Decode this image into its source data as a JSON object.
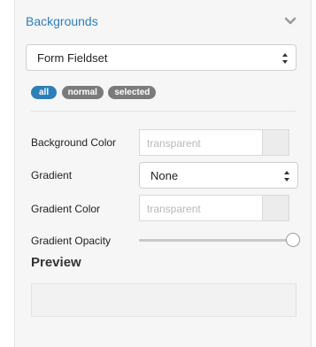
{
  "section": {
    "title": "Backgrounds",
    "toggle_icon": "chevron-down-icon"
  },
  "element_select": {
    "value": "Form Fieldset",
    "icon": "select-arrows-icon"
  },
  "state_pills": [
    {
      "label": "all",
      "active": true
    },
    {
      "label": "normal",
      "active": false
    },
    {
      "label": "selected",
      "active": false
    }
  ],
  "fields": {
    "background_color": {
      "label": "Background Color",
      "placeholder": "transparent"
    },
    "gradient": {
      "label": "Gradient",
      "value": "None"
    },
    "gradient_color": {
      "label": "Gradient Color",
      "placeholder": "transparent"
    },
    "gradient_opacity": {
      "label": "Gradient Opacity",
      "value": 1.0
    }
  },
  "preview": {
    "title": "Preview"
  },
  "colors": {
    "accent": "#2d7fb8",
    "pill_inactive": "#7b7b7b",
    "panel_bg": "#f6f6f6"
  }
}
